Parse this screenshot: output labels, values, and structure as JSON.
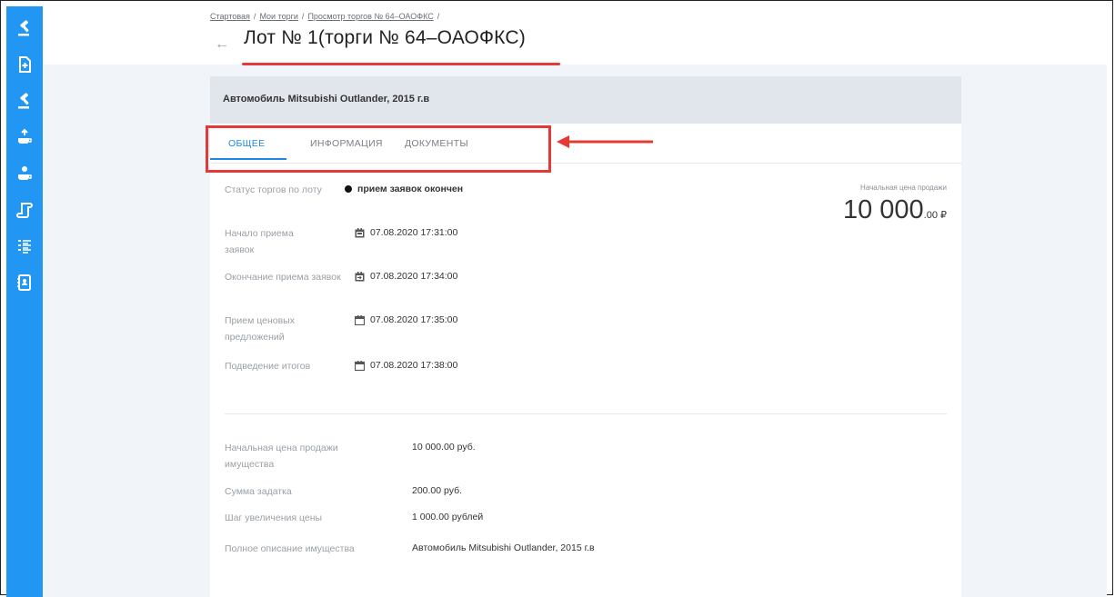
{
  "breadcrumb": [
    "Стартовая",
    "Мои торги",
    "Просмотр торгов № 64–ОАОФКС"
  ],
  "breadcrumb_separator": "/",
  "back_glyph": "←",
  "page_title": "Лот № 1(торги № 64–ОАОФКС)",
  "lot_name": "Автомобиль Mitsubishi Outlander, 2015 г.в",
  "tabs": [
    {
      "label": "ОБЩЕЕ",
      "active": true
    },
    {
      "label": "ИНФОРМАЦИЯ",
      "active": false
    },
    {
      "label": "ДОКУМЕНТЫ",
      "active": false
    }
  ],
  "status": {
    "label": "Статус торгов по лоту",
    "value": "прием заявок окончен"
  },
  "dates": [
    {
      "label": "Начало приема заявок",
      "value": "07.08.2020 17:31:00",
      "icon": "calendar-start-icon"
    },
    {
      "label": "Окончание приема заявок",
      "value": "07.08.2020 17:34:00",
      "icon": "calendar-end-icon"
    },
    {
      "label": "Прием ценовых предложений",
      "value": "07.08.2020 17:35:00",
      "icon": "calendar-icon"
    },
    {
      "label": "Подведение итогов",
      "value": "07.08.2020 17:38:00",
      "icon": "calendar-icon"
    }
  ],
  "price_panel": {
    "caption": "Начальная цена продажи",
    "amount": "10 000",
    "cents": ".00 ₽"
  },
  "details": [
    {
      "label": "Начальная цена продажи имущества",
      "value": "10 000.00 руб."
    },
    {
      "label": "Сумма задатка",
      "value": "200.00 руб."
    },
    {
      "label": "Шаг увеличения цены",
      "value": "1 000.00 рублей"
    },
    {
      "label": "Полное описание имущества",
      "value": "Автомобиль Mitsubishi Outlander, 2015 г.в"
    }
  ],
  "sidebar_icons": [
    "auction-gavel-icon",
    "add-document-icon",
    "auction-gavel-icon",
    "gavel-hand-up-icon",
    "gavel-hand-icon",
    "scroll-icon",
    "task-list-icon",
    "contacts-book-icon"
  ],
  "colors": {
    "sidebar": "#2196f3",
    "accent": "#1e88e5",
    "annotation": "#e53935",
    "card_header": "#e1e6ec",
    "page_bg": "#f1f4f8"
  }
}
